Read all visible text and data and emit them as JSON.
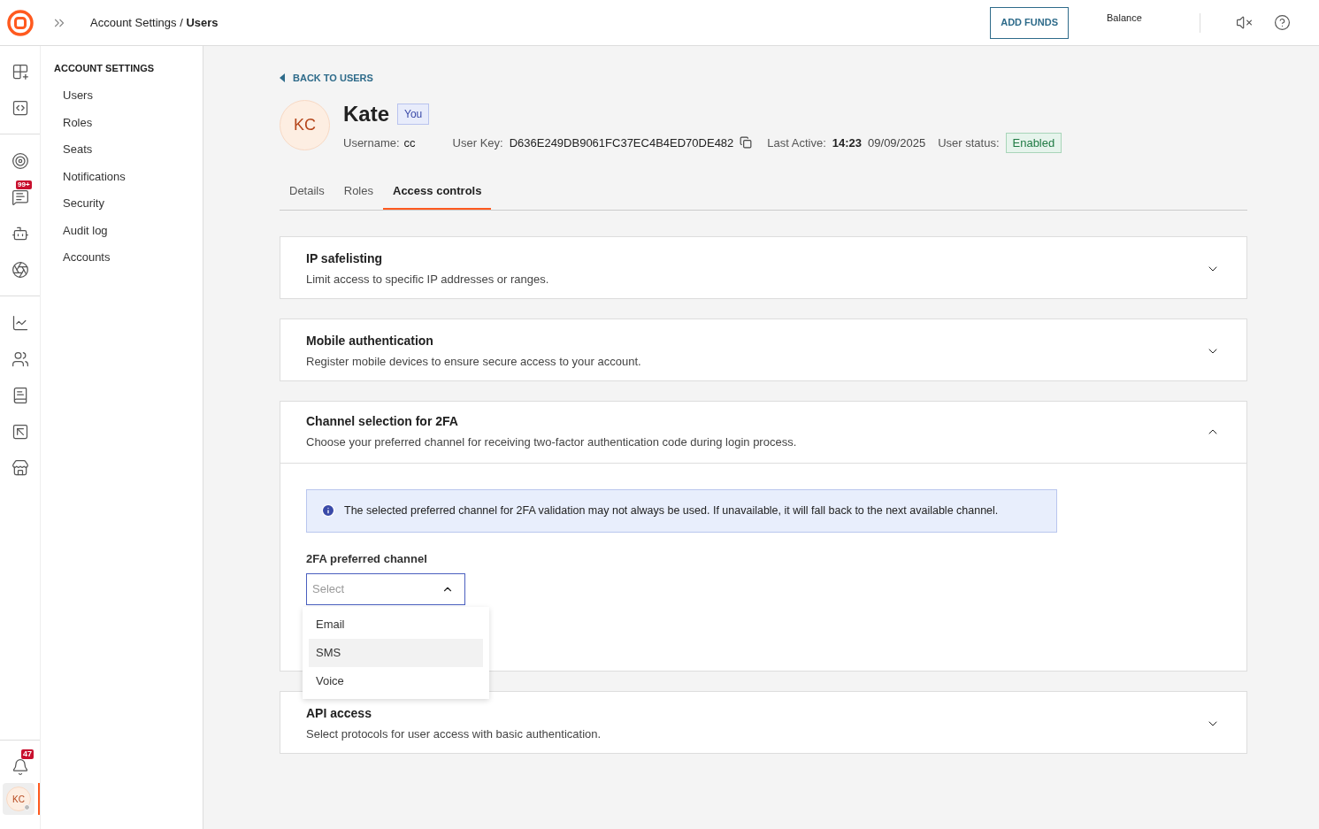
{
  "topbar": {
    "breadcrumb": "Account Settings / **Users**",
    "add_funds": "ADD FUNDS",
    "balance_label": "Balance"
  },
  "rail": {
    "badges": {
      "chat": "99+",
      "bell": "47"
    },
    "avatar": "KC"
  },
  "settings_nav": {
    "heading": "ACCOUNT SETTINGS",
    "items": [
      "Users",
      "Roles",
      "Seats",
      "Notifications",
      "Security",
      "Audit log",
      "Accounts"
    ]
  },
  "back_link": "BACK TO USERS",
  "profile": {
    "initials": "KC",
    "name": "Kate",
    "badge": "You",
    "username_label": "Username:",
    "username": "cc",
    "user_key_label": "User Key:",
    "user_key": "D636E249DB9061FC37EC4B4ED70DE482",
    "last_active_label": "Last Active:",
    "last_active_time": "14:23",
    "last_active_date": "09/09/2025",
    "status_label": "User status:",
    "status": "Enabled"
  },
  "tabs": [
    {
      "label": "Details",
      "selected": false
    },
    {
      "label": "Roles",
      "selected": false
    },
    {
      "label": "Access controls",
      "selected": true
    }
  ],
  "sections": [
    {
      "title": "IP safelisting",
      "description": "Limit access to specific IP addresses or ranges.",
      "expanded": false
    },
    {
      "title": "Mobile authentication",
      "description": "Register mobile devices to ensure secure access to your account.",
      "expanded": false
    },
    {
      "title": "Channel selection for 2FA",
      "description": "Choose your preferred channel for receiving two-factor authentication code during login process.",
      "expanded": true,
      "info": "The selected preferred channel for 2FA validation may not always be used. If unavailable, it will fall back to the next available channel.",
      "field_label": "2FA preferred channel",
      "placeholder": "Select",
      "dropdown_open": true,
      "options": [
        {
          "label": "Email",
          "highlighted": false
        },
        {
          "label": "SMS",
          "highlighted": true
        },
        {
          "label": "Voice",
          "highlighted": false
        }
      ]
    },
    {
      "title": "API access",
      "description": "Select protocols for user access with basic authentication.",
      "expanded": false
    }
  ]
}
